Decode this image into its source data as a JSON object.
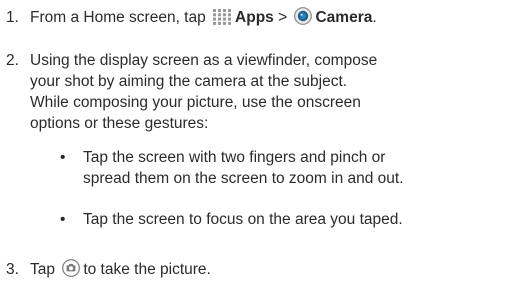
{
  "steps": [
    {
      "number": "1.",
      "parts": {
        "t1": "From a Home screen, tap",
        "apps": "Apps",
        "sep": ">",
        "camera": "Camera",
        "end": "."
      },
      "icons": [
        "apps-grid-icon",
        "camera-app-icon"
      ]
    },
    {
      "number": "2.",
      "lines": [
        "Using the display screen as a viewfinder, compose",
        "your shot by aiming the camera at the subject.",
        "While composing your picture, use the onscreen",
        "options or these gestures:"
      ]
    },
    {
      "number": "3.",
      "parts": {
        "t1": "Tap",
        "t2": "to take the picture."
      },
      "icons": [
        "shutter-button-icon"
      ]
    }
  ],
  "bullets": [
    {
      "symbol": "•",
      "lines": [
        "Tap the screen with two fingers and pinch or",
        "spread them on the screen to zoom in and out."
      ]
    },
    {
      "symbol": "•",
      "lines": [
        "Tap the screen to focus on the area you taped."
      ]
    }
  ],
  "colors": {
    "text": "#2b2b2b",
    "apps_icon": "#9a9a9a",
    "camera_icon_ring": "#8a8a8a",
    "camera_icon_lens": "#2a7fb8",
    "shutter_icon": "#7a7a7a"
  }
}
